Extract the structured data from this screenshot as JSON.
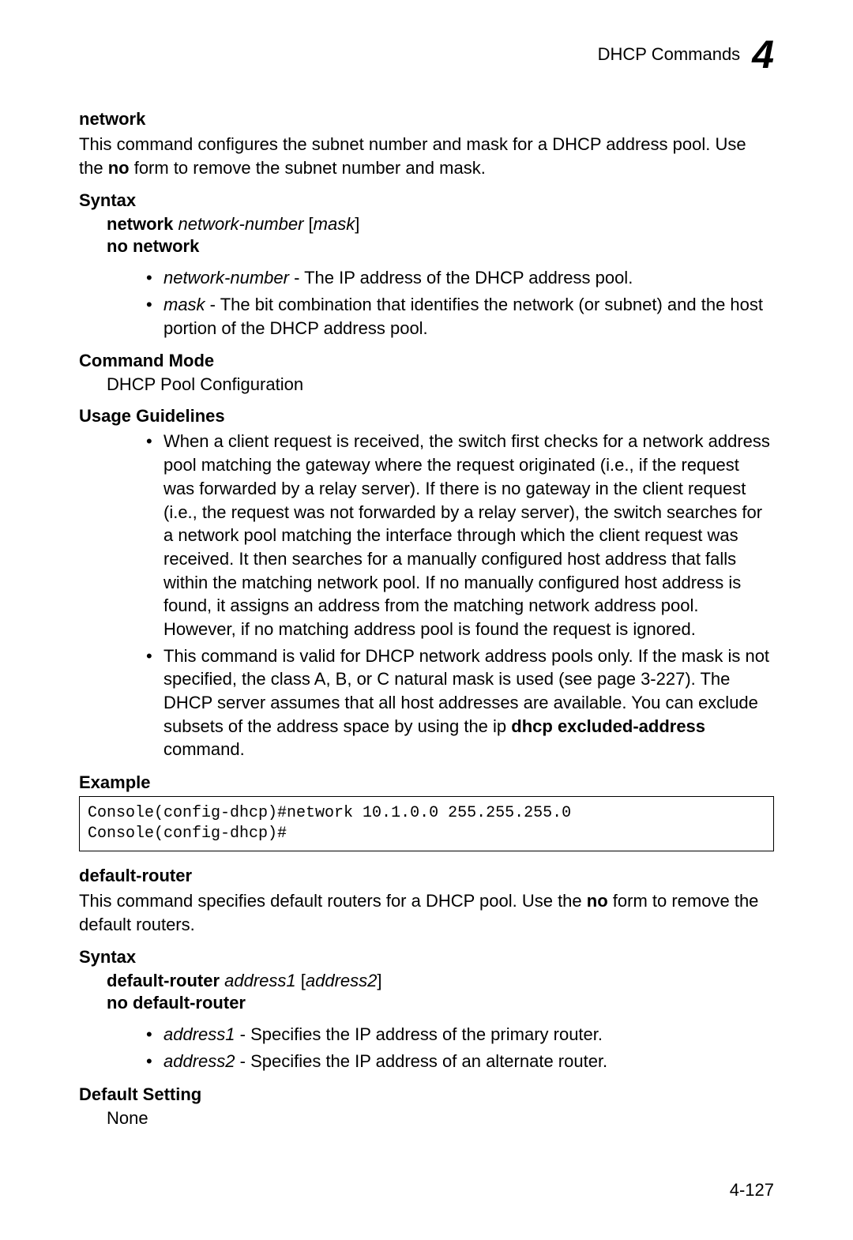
{
  "header": {
    "title": "DHCP Commands",
    "chapter": "4"
  },
  "section1": {
    "title": "network",
    "intro_part1": "This command configures the subnet number and mask for a DHCP address pool. Use the ",
    "intro_bold": "no",
    "intro_part2": " form to remove the subnet number and mask.",
    "syntax_heading": "Syntax",
    "syntax_cmd_bold": "network",
    "syntax_cmd_italic1": " network-number",
    "syntax_cmd_bracket_open": " [",
    "syntax_cmd_italic2": "mask",
    "syntax_cmd_bracket_close": "]",
    "syntax_no": "no network",
    "param1_name": "network-number",
    "param1_desc": " - The IP address of the DHCP address pool.",
    "param2_name": "mask",
    "param2_desc": " - The bit combination that identifies the network (or subnet) and the host portion of the DHCP address pool.",
    "cmd_mode_heading": "Command Mode",
    "cmd_mode_text": "DHCP Pool Configuration",
    "usage_heading": "Usage Guidelines",
    "usage_item1": "When a client request is received, the switch first checks for a network address pool matching the gateway where the request originated (i.e., if the request was forwarded by a relay server). If there is no gateway in the client request (i.e., the request was not forwarded by a relay server), the switch searches for a network pool matching the interface through which the client request was received. It then searches for a manually configured host address that falls within the matching network pool. If no manually configured host address is found, it assigns an address from the matching network address pool. However, if no matching address pool is found the request is ignored.",
    "usage_item2_part1": "This command is valid for DHCP network address pools only. If the mask is not specified, the class A, B, or C natural mask is used (see page 3-227). The DHCP server assumes that all host addresses are available. You can exclude subsets of the address space by using the ip ",
    "usage_item2_bold": "dhcp excluded-address",
    "usage_item2_part2": " command.",
    "example_heading": "Example",
    "example_code": "Console(config-dhcp)#network 10.1.0.0 255.255.255.0\nConsole(config-dhcp)#"
  },
  "section2": {
    "title": "default-router",
    "intro_part1": "This command specifies default routers for a DHCP pool. Use the ",
    "intro_bold": "no",
    "intro_part2": " form to remove the default routers.",
    "syntax_heading": "Syntax",
    "syntax_cmd_bold": "default-router",
    "syntax_cmd_italic1": " address1",
    "syntax_cmd_bracket_open": " [",
    "syntax_cmd_italic2": "address2",
    "syntax_cmd_bracket_close": "]",
    "syntax_no": "no default-router",
    "param1_name": "address1",
    "param1_desc": " - Specifies the IP address of the primary router.",
    "param2_name": "address2",
    "param2_desc": " - Specifies the IP address of an alternate router.",
    "default_heading": "Default Setting",
    "default_text": "None"
  },
  "page_number": "4-127"
}
